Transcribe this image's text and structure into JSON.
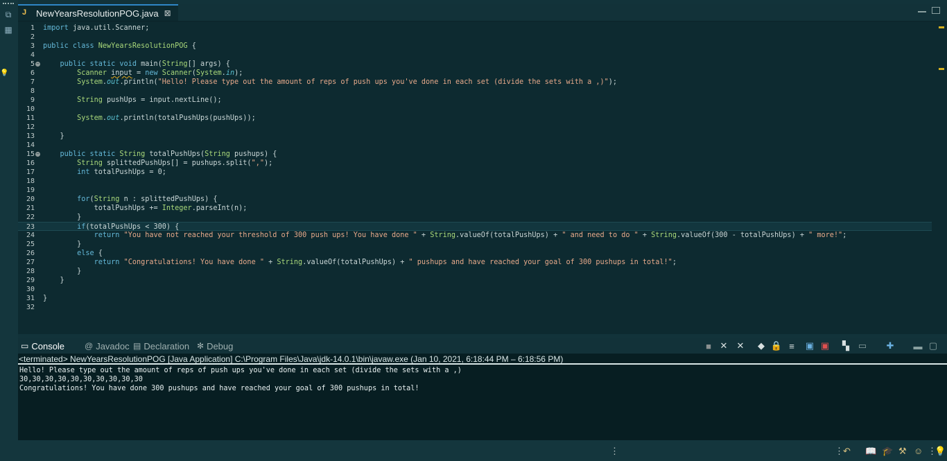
{
  "editor": {
    "tab_title": "NewYearsResolutionPOG.java",
    "tab_close": "⊠",
    "lines": [
      {
        "n": "1",
        "html": "<span class=\"kw\">import</span> java.util.Scanner;"
      },
      {
        "n": "2",
        "html": ""
      },
      {
        "n": "3",
        "html": "<span class=\"kw\">public class</span> <span class=\"ty\">NewYearsResolutionPOG</span> {"
      },
      {
        "n": "4",
        "html": ""
      },
      {
        "n": "5",
        "fold": true,
        "html": "    <span class=\"kw\">public static void</span> main(<span class=\"ty\">String</span>[] args) {"
      },
      {
        "n": "6",
        "bulb": true,
        "html": "        <span class=\"ty\">Scanner</span> <span class=\"squig\">input</span> = <span class=\"kw\">new</span> <span class=\"ty\">Scanner</span>(<span class=\"ty\">System</span>.<span class=\"fld\">in</span>);"
      },
      {
        "n": "7",
        "html": "        <span class=\"ty\">System</span>.<span class=\"fld\">out</span>.println(<span class=\"str\">\"Hello! Please type out the amount of reps of push ups you've done in each set (divide the sets with a ,)\"</span>);"
      },
      {
        "n": "8",
        "html": ""
      },
      {
        "n": "9",
        "html": "        <span class=\"ty\">String</span> pushUps = input.nextLine();"
      },
      {
        "n": "10",
        "html": ""
      },
      {
        "n": "11",
        "html": "        <span class=\"ty\">System</span>.<span class=\"fld\">out</span>.println(totalPushUps(pushUps));"
      },
      {
        "n": "12",
        "html": ""
      },
      {
        "n": "13",
        "html": "    }"
      },
      {
        "n": "14",
        "html": ""
      },
      {
        "n": "15",
        "fold": true,
        "html": "    <span class=\"kw\">public static</span> <span class=\"ty\">String</span> totalPushUps(<span class=\"ty\">String</span> pushups) {"
      },
      {
        "n": "16",
        "html": "        <span class=\"ty\">String</span> splittedPushUps[] = pushups.split(<span class=\"str\">\",\"</span>);"
      },
      {
        "n": "17",
        "html": "        <span class=\"kw\">int</span> totalPushUps = 0;"
      },
      {
        "n": "18",
        "html": ""
      },
      {
        "n": "19",
        "html": ""
      },
      {
        "n": "20",
        "html": "        <span class=\"kw\">for</span>(<span class=\"ty\">String</span> n : splittedPushUps) {"
      },
      {
        "n": "21",
        "html": "            totalPushUps += <span class=\"ty\">Integer</span>.parseInt(n);"
      },
      {
        "n": "22",
        "html": "        }"
      },
      {
        "n": "23",
        "current": true,
        "html": "        <span class=\"kw\">if</span>(totalPushUps < 300) {"
      },
      {
        "n": "24",
        "html": "            <span class=\"kw\">return</span> <span class=\"str\">\"You have not reached your threshold of 300 push ups! You have done \"</span> + <span class=\"ty\">String</span>.valueOf(totalPushUps) + <span class=\"str\">\" and need to do \"</span> + <span class=\"ty\">String</span>.valueOf(300 - totalPushUps) + <span class=\"str\">\" more!\"</span>;"
      },
      {
        "n": "25",
        "html": "        }"
      },
      {
        "n": "26",
        "html": "        <span class=\"kw\">else</span> {"
      },
      {
        "n": "27",
        "html": "            <span class=\"kw\">return</span> <span class=\"str\">\"Congratulations! You have done \"</span> + <span class=\"ty\">String</span>.valueOf(totalPushUps) + <span class=\"str\">\" pushups and have reached your goal of 300 pushups in total!\"</span>;"
      },
      {
        "n": "28",
        "html": "        }"
      },
      {
        "n": "29",
        "html": "    }"
      },
      {
        "n": "30",
        "html": ""
      },
      {
        "n": "31",
        "html": "}"
      },
      {
        "n": "32",
        "html": ""
      }
    ]
  },
  "console": {
    "tabs": [
      {
        "label": "Console",
        "icon": "▭",
        "active": true,
        "name": "console"
      },
      {
        "label": "Javadoc",
        "icon": "@",
        "active": false,
        "name": "javadoc"
      },
      {
        "label": "Declaration",
        "icon": "▤",
        "active": false,
        "name": "declaration"
      },
      {
        "label": "Debug",
        "icon": "✻",
        "active": false,
        "name": "debug"
      }
    ],
    "status": "<terminated> NewYearsResolutionPOG [Java Application] C:\\Program Files\\Java\\jdk-14.0.1\\bin\\javaw.exe  (Jan 10, 2021, 6:18:44 PM – 6:18:56 PM)",
    "output": [
      "Hello! Please type out the amount of reps of push ups you've done in each set (divide the sets with a ,)",
      "30,30,30,30,30,30,30,30,30,30",
      "Congratulations! You have done 300 pushups and have reached your goal of 300 pushups in total!"
    ]
  },
  "colors": {
    "accent": "#2f86c6",
    "background": "#0d2a30",
    "console_bg": "#071e22"
  }
}
